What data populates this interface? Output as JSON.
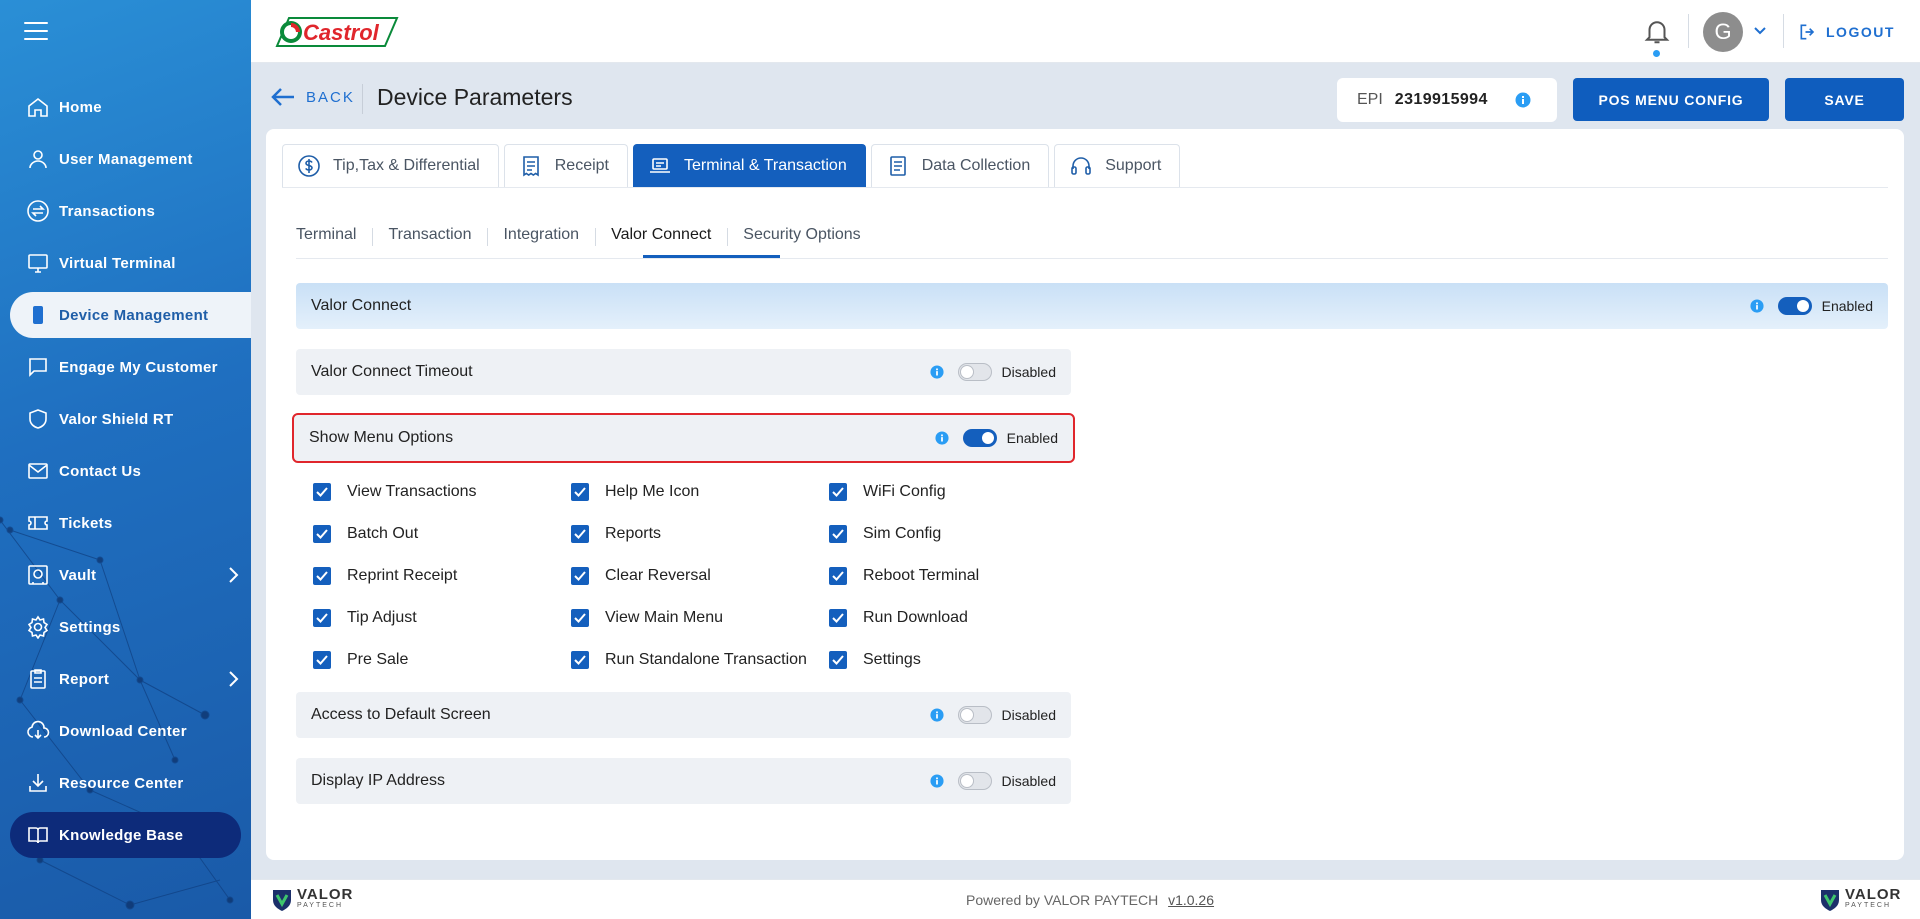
{
  "sidebar": {
    "items": [
      {
        "label": "Home",
        "icon": "home-icon"
      },
      {
        "label": "User Management",
        "icon": "user-icon"
      },
      {
        "label": "Transactions",
        "icon": "exchange-icon"
      },
      {
        "label": "Virtual Terminal",
        "icon": "monitor-icon"
      },
      {
        "label": "Device Management",
        "icon": "device-icon"
      },
      {
        "label": "Engage My Customer",
        "icon": "chat-icon"
      },
      {
        "label": "Valor Shield RT",
        "icon": "shield-icon"
      },
      {
        "label": "Contact Us",
        "icon": "mail-icon"
      },
      {
        "label": "Tickets",
        "icon": "ticket-icon"
      },
      {
        "label": "Vault",
        "icon": "vault-icon"
      },
      {
        "label": "Settings",
        "icon": "gear-icon"
      },
      {
        "label": "Report",
        "icon": "report-icon"
      },
      {
        "label": "Download Center",
        "icon": "cloud-download-icon"
      },
      {
        "label": "Resource Center",
        "icon": "download-icon"
      },
      {
        "label": "Knowledge Base",
        "icon": "book-icon"
      }
    ],
    "active": "Device Management"
  },
  "topbar": {
    "brand": "Castrol",
    "avatar_initial": "G",
    "logout_label": "LOGOUT"
  },
  "header": {
    "back_label": "BACK",
    "title": "Device Parameters",
    "epi_label": "EPI",
    "epi_value": "2319915994",
    "pos_menu_label": "POS MENU CONFIG",
    "save_label": "SAVE"
  },
  "tabs": [
    {
      "label": "Tip,Tax & Differential",
      "icon": "dollar-icon"
    },
    {
      "label": "Receipt",
      "icon": "receipt-icon"
    },
    {
      "label": "Terminal & Transaction",
      "icon": "laptop-icon"
    },
    {
      "label": "Data Collection",
      "icon": "document-icon"
    },
    {
      "label": "Support",
      "icon": "headset-icon"
    }
  ],
  "active_tab": "Terminal & Transaction",
  "subtabs": [
    "Terminal",
    "Transaction",
    "Integration",
    "Valor Connect",
    "Security Options"
  ],
  "active_subtab": "Valor Connect",
  "settings": {
    "valor_connect": {
      "label": "Valor Connect",
      "state": "Enabled"
    },
    "timeout": {
      "label": "Valor Connect Timeout",
      "state": "Disabled"
    },
    "show_menu": {
      "label": "Show Menu Options",
      "state": "Enabled"
    },
    "default_screen": {
      "label": "Access to Default Screen",
      "state": "Disabled"
    },
    "display_ip": {
      "label": "Display IP Address",
      "state": "Disabled"
    }
  },
  "menu_options": [
    "View Transactions",
    "Batch Out",
    "Reprint Receipt",
    "Tip Adjust",
    "Pre Sale",
    "Help Me Icon",
    "Reports",
    "Clear Reversal",
    "View Main Menu",
    "Run Standalone Transaction",
    "WiFi Config",
    "Sim Config",
    "Reboot Terminal",
    "Run Download",
    "Settings"
  ],
  "footer": {
    "powered_by": "Powered by VALOR PAYTECH",
    "version": "v1.0.26",
    "logo_word": "VALOR",
    "logo_sub": "PAYTECH"
  },
  "colors": {
    "primary": "#145fbd",
    "sidebar": "#1f6fc0",
    "highlight": "#e0262c"
  }
}
